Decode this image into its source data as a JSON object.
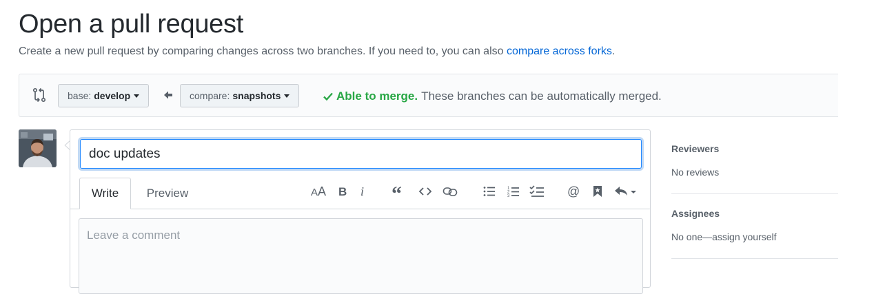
{
  "page": {
    "title": "Open a pull request",
    "subtitle": "Create a new pull request by comparing changes across two branches. If you need to, you can also ",
    "subtitle_link": "compare across forks",
    "subtitle_end": "."
  },
  "compare": {
    "base_prefix": "base:",
    "base_branch": "develop",
    "compare_prefix": "compare:",
    "compare_branch": "snapshots",
    "merge_ok": "Able to merge.",
    "merge_text": "These branches can be automatically merged.",
    "merge_color": "#28a745"
  },
  "editor": {
    "title_value": "doc updates",
    "tabs": [
      {
        "label": "Write",
        "active": true
      },
      {
        "label": "Preview",
        "active": false
      }
    ],
    "comment_placeholder": "Leave a comment",
    "toolbar_icons": [
      "text-size-icon",
      "bold-icon",
      "italic-icon",
      "quote-icon",
      "code-icon",
      "link-icon",
      "bulleted-list-icon",
      "numbered-list-icon",
      "task-list-icon",
      "mention-icon",
      "bookmark-icon",
      "reply-icon"
    ]
  },
  "sidebar": {
    "sections": [
      {
        "title": "Reviewers",
        "value": "No reviews"
      },
      {
        "title": "Assignees",
        "value": "No one—assign yourself"
      }
    ]
  },
  "colors": {
    "accent": "#0366d6",
    "focus": "#2188ff",
    "muted": "#586069"
  }
}
